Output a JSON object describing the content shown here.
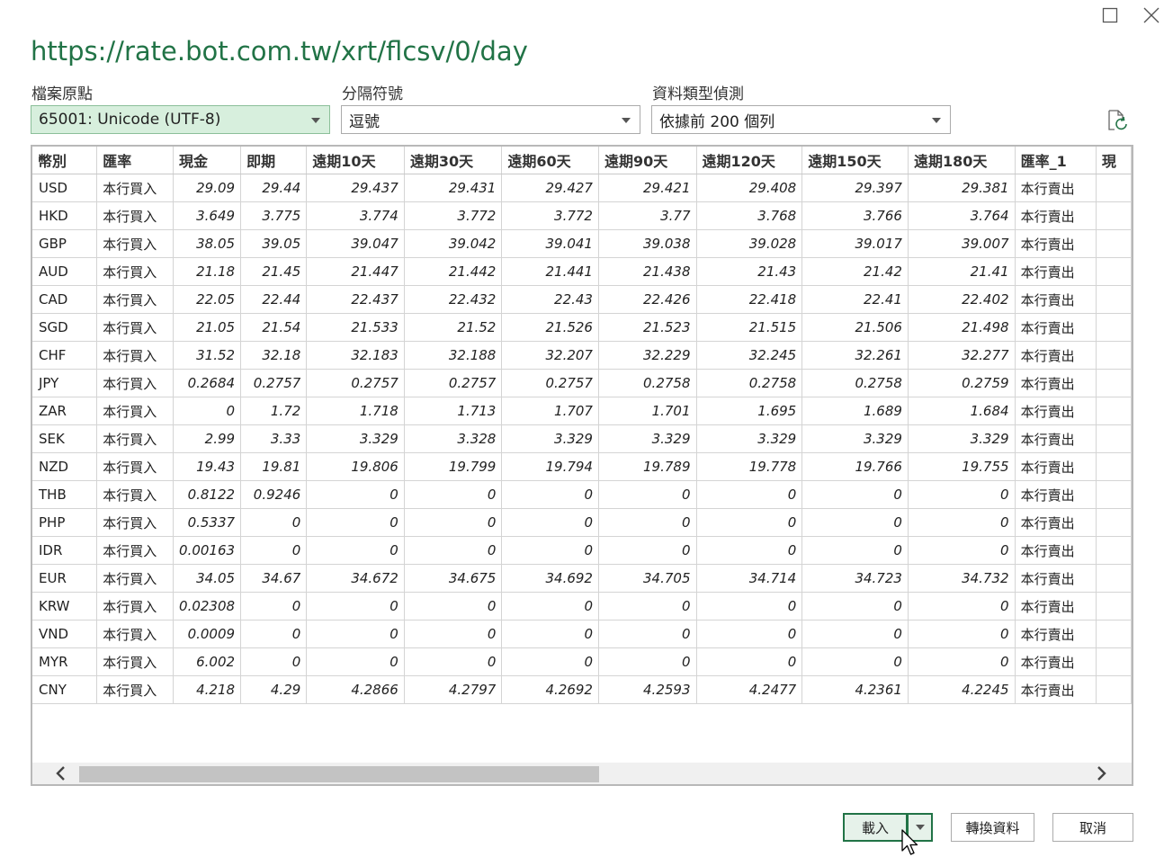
{
  "window": {
    "title": "https://rate.bot.com.tw/xrt/flcsv/0/day"
  },
  "icons": {
    "maximize": "maximize-icon",
    "close": "close-icon",
    "refresh": "refresh-icon",
    "dropdown": "chevron-down-icon",
    "scroll_left": "chevron-left-icon",
    "scroll_right": "chevron-right-icon",
    "cursor": "mouse-pointer-icon"
  },
  "options": {
    "file_origin": {
      "label": "檔案原點",
      "value": "65001: Unicode (UTF-8)"
    },
    "delimiter": {
      "label": "分隔符號",
      "value": "逗號"
    },
    "type_detection": {
      "label": "資料類型偵測",
      "value": "依據前 200 個列"
    }
  },
  "table": {
    "columns": [
      "幣別",
      "匯率",
      "現金",
      "即期",
      "遠期10天",
      "遠期30天",
      "遠期60天",
      "遠期90天",
      "遠期120天",
      "遠期150天",
      "遠期180天",
      "匯率_1",
      "現"
    ],
    "rows": [
      [
        "USD",
        "本行買入",
        "29.09",
        "29.44",
        "29.437",
        "29.431",
        "29.427",
        "29.421",
        "29.408",
        "29.397",
        "29.381",
        "本行賣出"
      ],
      [
        "HKD",
        "本行買入",
        "3.649",
        "3.775",
        "3.774",
        "3.772",
        "3.772",
        "3.77",
        "3.768",
        "3.766",
        "3.764",
        "本行賣出"
      ],
      [
        "GBP",
        "本行買入",
        "38.05",
        "39.05",
        "39.047",
        "39.042",
        "39.041",
        "39.038",
        "39.028",
        "39.017",
        "39.007",
        "本行賣出"
      ],
      [
        "AUD",
        "本行買入",
        "21.18",
        "21.45",
        "21.447",
        "21.442",
        "21.441",
        "21.438",
        "21.43",
        "21.42",
        "21.41",
        "本行賣出"
      ],
      [
        "CAD",
        "本行買入",
        "22.05",
        "22.44",
        "22.437",
        "22.432",
        "22.43",
        "22.426",
        "22.418",
        "22.41",
        "22.402",
        "本行賣出"
      ],
      [
        "SGD",
        "本行買入",
        "21.05",
        "21.54",
        "21.533",
        "21.52",
        "21.526",
        "21.523",
        "21.515",
        "21.506",
        "21.498",
        "本行賣出"
      ],
      [
        "CHF",
        "本行買入",
        "31.52",
        "32.18",
        "32.183",
        "32.188",
        "32.207",
        "32.229",
        "32.245",
        "32.261",
        "32.277",
        "本行賣出"
      ],
      [
        "JPY",
        "本行買入",
        "0.2684",
        "0.2757",
        "0.2757",
        "0.2757",
        "0.2757",
        "0.2758",
        "0.2758",
        "0.2758",
        "0.2759",
        "本行賣出"
      ],
      [
        "ZAR",
        "本行買入",
        "0",
        "1.72",
        "1.718",
        "1.713",
        "1.707",
        "1.701",
        "1.695",
        "1.689",
        "1.684",
        "本行賣出"
      ],
      [
        "SEK",
        "本行買入",
        "2.99",
        "3.33",
        "3.329",
        "3.328",
        "3.329",
        "3.329",
        "3.329",
        "3.329",
        "3.329",
        "本行賣出"
      ],
      [
        "NZD",
        "本行買入",
        "19.43",
        "19.81",
        "19.806",
        "19.799",
        "19.794",
        "19.789",
        "19.778",
        "19.766",
        "19.755",
        "本行賣出"
      ],
      [
        "THB",
        "本行買入",
        "0.8122",
        "0.9246",
        "0",
        "0",
        "0",
        "0",
        "0",
        "0",
        "0",
        "本行賣出"
      ],
      [
        "PHP",
        "本行買入",
        "0.5337",
        "0",
        "0",
        "0",
        "0",
        "0",
        "0",
        "0",
        "0",
        "本行賣出"
      ],
      [
        "IDR",
        "本行買入",
        "0.00163",
        "0",
        "0",
        "0",
        "0",
        "0",
        "0",
        "0",
        "0",
        "本行賣出"
      ],
      [
        "EUR",
        "本行買入",
        "34.05",
        "34.67",
        "34.672",
        "34.675",
        "34.692",
        "34.705",
        "34.714",
        "34.723",
        "34.732",
        "本行賣出"
      ],
      [
        "KRW",
        "本行買入",
        "0.02308",
        "0",
        "0",
        "0",
        "0",
        "0",
        "0",
        "0",
        "0",
        "本行賣出"
      ],
      [
        "VND",
        "本行買入",
        "0.0009",
        "0",
        "0",
        "0",
        "0",
        "0",
        "0",
        "0",
        "0",
        "本行賣出"
      ],
      [
        "MYR",
        "本行買入",
        "6.002",
        "0",
        "0",
        "0",
        "0",
        "0",
        "0",
        "0",
        "0",
        "本行賣出"
      ],
      [
        "CNY",
        "本行買入",
        "4.218",
        "4.29",
        "4.2866",
        "4.2797",
        "4.2692",
        "4.2593",
        "4.2477",
        "4.2361",
        "4.2245",
        "本行賣出"
      ]
    ]
  },
  "footer": {
    "load_label": "載入",
    "transform_label": "轉換資料",
    "cancel_label": "取消"
  },
  "colors": {
    "accent": "#217346",
    "selected_bg": "#d7efdd"
  }
}
